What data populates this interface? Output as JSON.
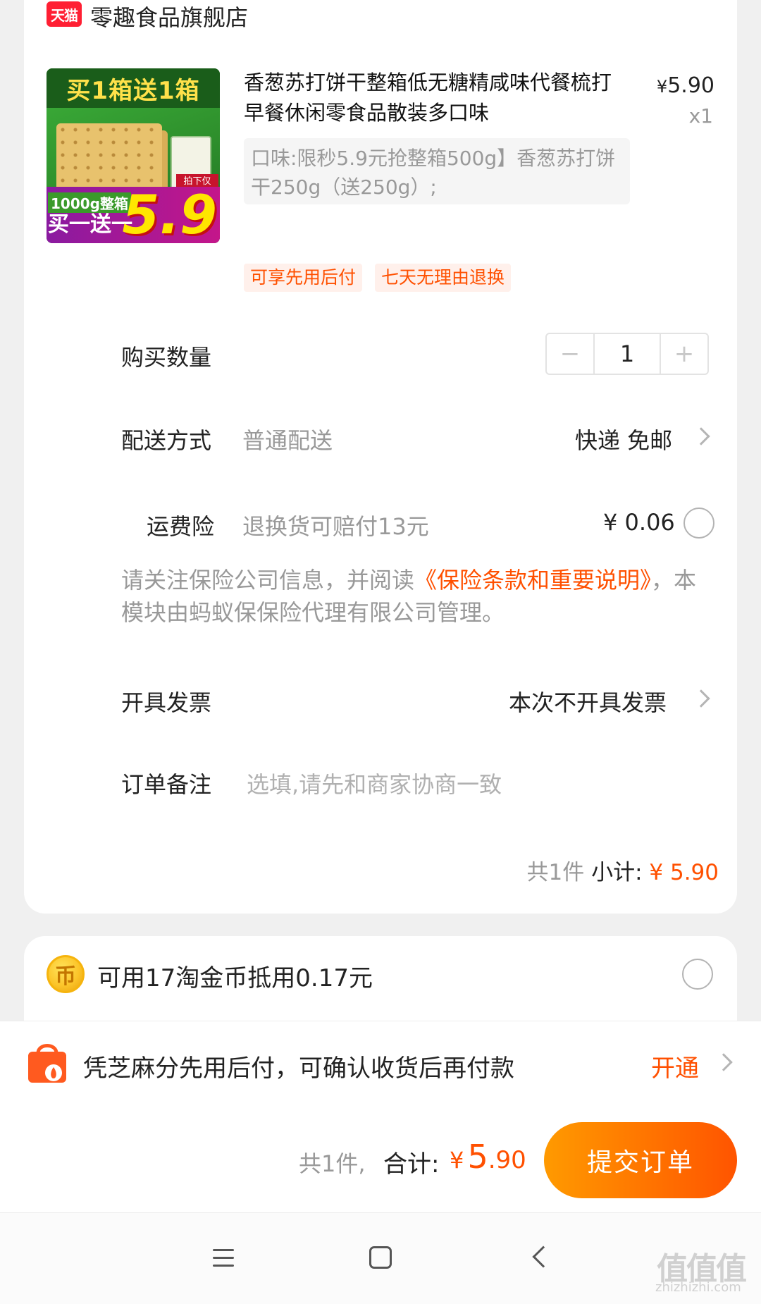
{
  "store": {
    "logo_text": "天猫",
    "name": "零趣食品旗舰店"
  },
  "product": {
    "image": {
      "headline": "买1箱送1箱",
      "weight": "1000g整箱",
      "promo": "买一送一",
      "price": "5.9",
      "tag": "拍下仅"
    },
    "title": "香葱苏打饼干整箱低无糖精咸味代餐梳打早餐休闲零食品散装多口味",
    "price_symbol": "¥",
    "price": "5.90",
    "quantity": "x1",
    "spec": "口味:限秒5.9元抢整箱500g】香葱苏打饼干250g（送250g）;",
    "tags": [
      "可享先用后付",
      "七天无理由退换"
    ]
  },
  "quantity_row": {
    "label": "购买数量",
    "minus": "−",
    "value": "1",
    "plus": "+"
  },
  "delivery_row": {
    "label": "配送方式",
    "method": "普通配送",
    "value": "快递 免邮"
  },
  "insurance_row": {
    "label": "运费险",
    "desc": "退换货可赔付13元",
    "price": "¥ 0.06"
  },
  "insurance_notice": {
    "text_before": "请关注保险公司信息，并阅读",
    "link": "《保险条款和重要说明》",
    "text_after": "，本模块由蚂蚁保保险代理有限公司管理。"
  },
  "invoice_row": {
    "label": "开具发票",
    "value": "本次不开具发票"
  },
  "remark_row": {
    "label": "订单备注",
    "placeholder": "选填,请先和商家协商一致"
  },
  "subtotal": {
    "count": "共1件",
    "label": "小计:",
    "price": "¥ 5.90"
  },
  "coins": {
    "icon_text": "币",
    "text": "可用17淘金币抵用0.17元"
  },
  "pay_later": {
    "text": "凭芝麻分先用后付，可确认收货后再付款",
    "action": "开通"
  },
  "footer": {
    "count": "共1件,",
    "total_label": "合计:",
    "yen": "¥",
    "total_int": "5",
    "total_dec": ".90",
    "submit": "提交订单"
  },
  "watermark": {
    "text": "值值值",
    "sub": "zhizhizhi.com"
  },
  "colors": {
    "accent": "#ff5000",
    "brand_red": "#ff1f33",
    "muted": "#999999"
  }
}
